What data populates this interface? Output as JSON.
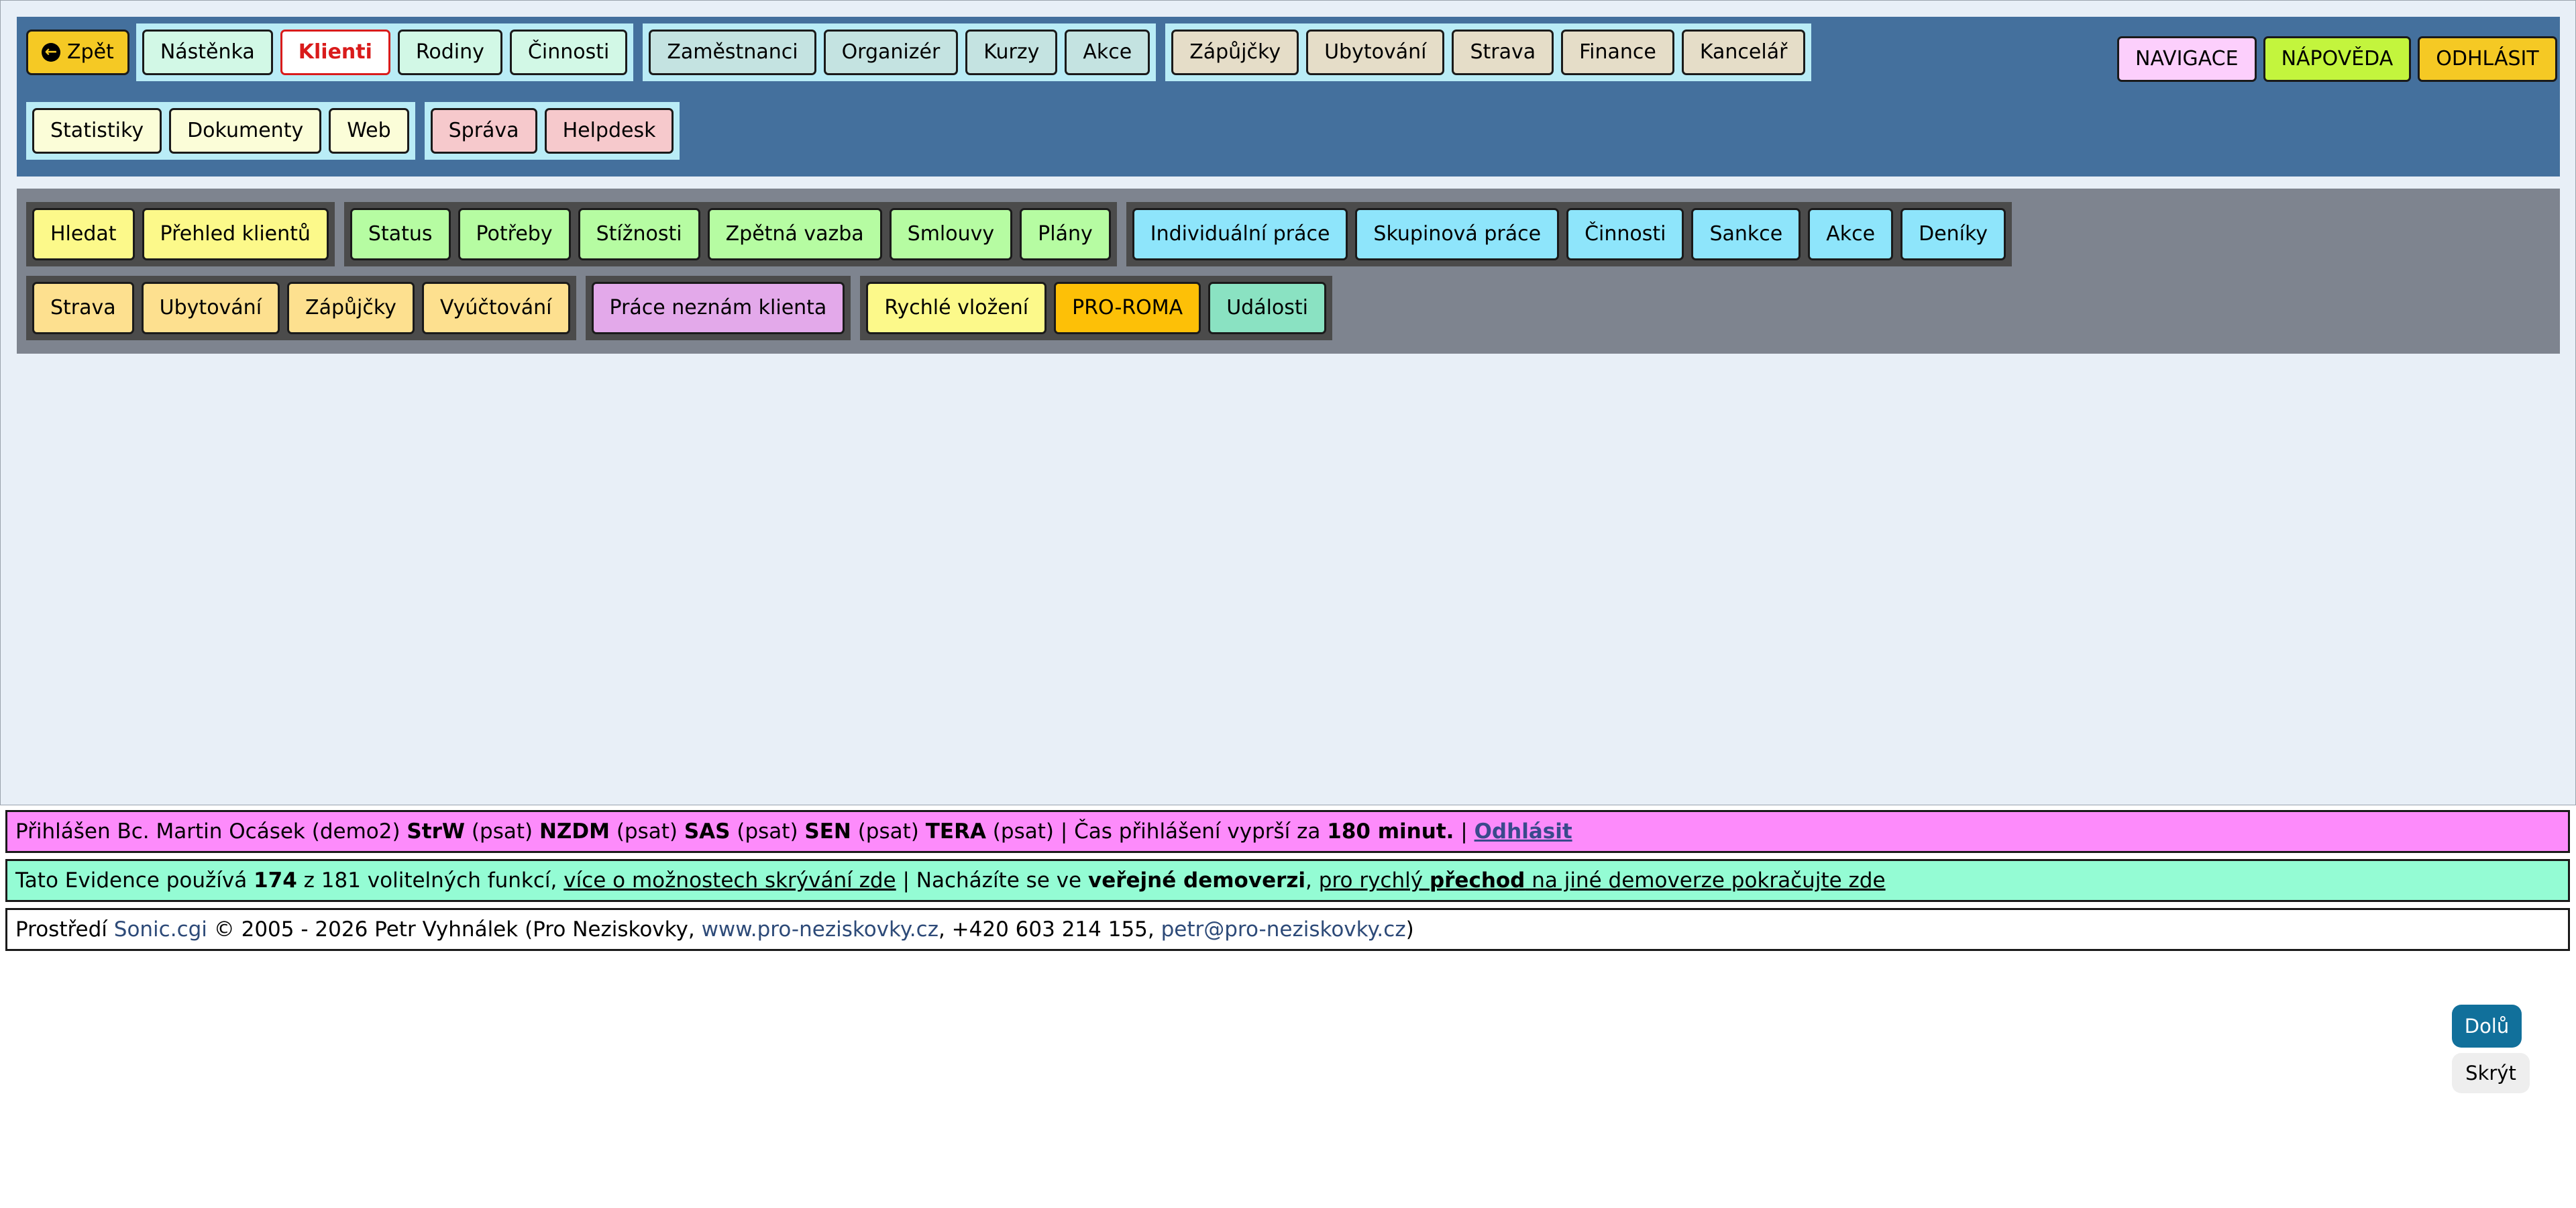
{
  "top_nav": {
    "back_label": "Zpět",
    "group1": [
      "Nástěnka",
      "Klienti",
      "Rodiny",
      "Činnosti"
    ],
    "group2": [
      "Zaměstnanci",
      "Organizér",
      "Kurzy",
      "Akce"
    ],
    "group3": [
      "Zápůjčky",
      "Ubytování",
      "Strava",
      "Finance",
      "Kancelář"
    ],
    "right": [
      "NAVIGACE",
      "NÁPOVĚDA",
      "ODHLÁSIT"
    ],
    "group4": [
      "Statistiky",
      "Dokumenty",
      "Web"
    ],
    "group5": [
      "Správa",
      "Helpdesk"
    ],
    "active_item": "Klienti"
  },
  "sub_nav": {
    "row1_group1": [
      "Hledat",
      "Přehled klientů"
    ],
    "row1_group2": [
      "Status",
      "Potřeby",
      "Stížnosti",
      "Zpětná vazba",
      "Smlouvy",
      "Plány"
    ],
    "row1_group3": [
      "Individuální práce",
      "Skupinová práce",
      "Činnosti",
      "Sankce",
      "Akce",
      "Deníky"
    ],
    "row2_group1": [
      "Strava",
      "Ubytování",
      "Zápůjčky",
      "Vyúčtování"
    ],
    "row2_group2": [
      "Práce neznám klienta"
    ],
    "row2_group3": [
      "Rychlé vložení",
      "PRO-ROMA",
      "Události"
    ]
  },
  "login_bar": {
    "prefix": "Přihlášen Bc. Martin Ocásek (demo2) ",
    "s1": "StrW",
    "p1": " (psat) ",
    "s2": "NZDM",
    "p2": " (psat) ",
    "s3": "SAS",
    "p3": " (psat) ",
    "s4": "SEN",
    "p4": " (psat) ",
    "s5": "TERA",
    "p5": " (psat)  |  Čas přihlášení vyprší za ",
    "minutes": "180 minut.",
    "sep": "  |  ",
    "logout": "Odhlásit"
  },
  "feature_bar": {
    "t1": "Tato Evidence používá ",
    "count": "174",
    "t2": " z 181 volitelných funkcí, ",
    "link1": "více o možnostech skrývání zde",
    "t3": "  |  Nacházíte se ve ",
    "demo": "veřejné demoverzi",
    "t4": ", ",
    "link2a": "pro rychlý ",
    "link2b": "přechod",
    "link2c": " na jiné demoverze pokračujte zde"
  },
  "footer_bar": {
    "t1": "Prostředí ",
    "sonic": "Sonic.cgi",
    "t2": " © 2005 - 2026 Petr Vyhnálek (Pro Neziskovky, ",
    "web": "www.pro-neziskovky.cz",
    "t3": ", +420 603 214 155, ",
    "email": "petr@pro-neziskovky.cz",
    "t4": ")"
  },
  "floating": {
    "down_label": "Dolů",
    "hide_label": "Skrýt"
  },
  "colors": {
    "top_nav_bg": "#44709d",
    "sub_nav_bg": "#7e848f",
    "login_bar_bg": "#fd8bfb",
    "feature_bar_bg": "#94fcd4"
  }
}
